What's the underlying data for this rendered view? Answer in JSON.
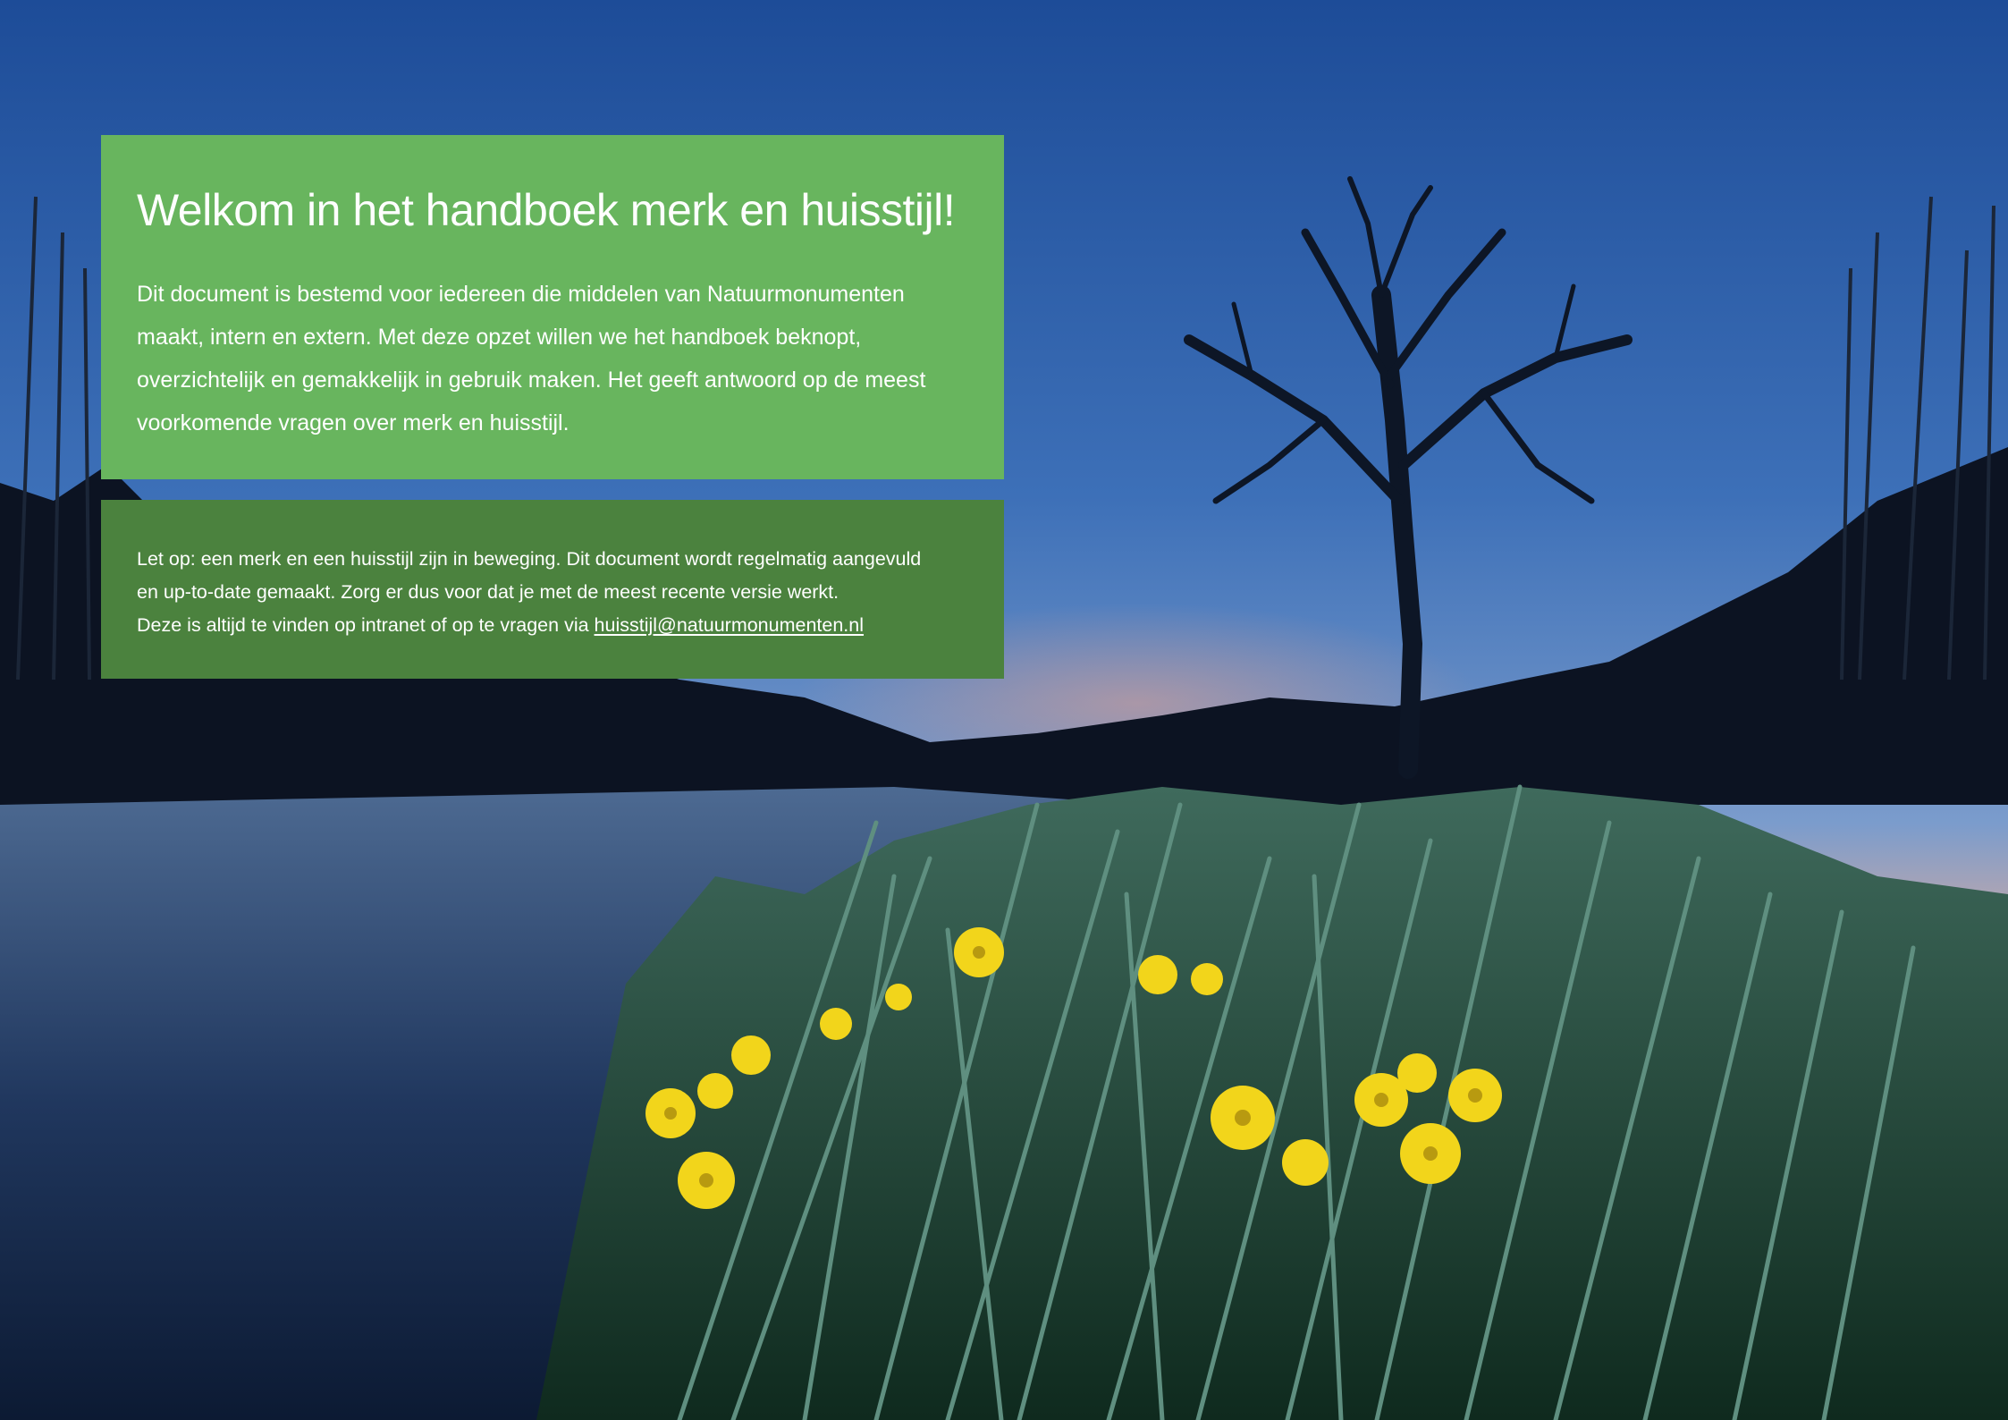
{
  "welcome": {
    "title": "Welkom in het handboek merk en huisstijl!",
    "intro": "Dit document is bestemd voor iedereen die middelen van Natuurmonumenten maakt, intern en extern. Met deze opzet willen we het handboek beknopt, overzichtelijk en gemakkelijk in gebruik maken. Het geeft antwoord op de meest voorkomende vragen over merk en huisstijl."
  },
  "notice": {
    "line1": "Let op: een merk en een huisstijl zijn in beweging. Dit document wordt regelmatig aangevuld",
    "line2": "en up-to-date gemaakt. Zorg er dus voor dat je met de meest recente versie werkt.",
    "line3_prefix": "Deze is altijd te vinden op intranet of op te vragen via ",
    "email": "huisstijl@natuurmonumenten.nl"
  },
  "colors": {
    "panel_light_green": "#68b55e",
    "panel_dark_green": "#4b823e",
    "text": "#ffffff"
  }
}
